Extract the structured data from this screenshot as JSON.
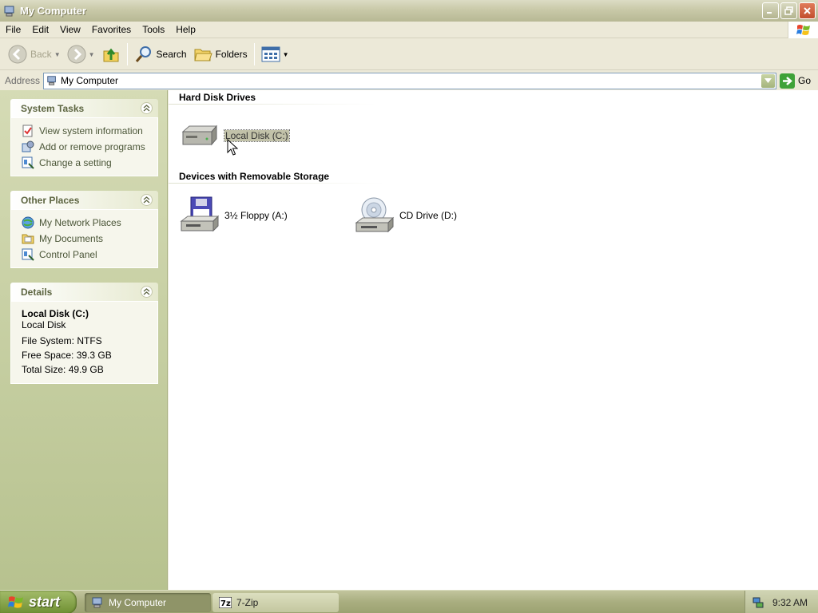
{
  "window": {
    "title": "My Computer",
    "icon": "my-computer-icon"
  },
  "menu": [
    "File",
    "Edit",
    "View",
    "Favorites",
    "Tools",
    "Help"
  ],
  "toolbar": {
    "back": "Back",
    "search": "Search",
    "folders": "Folders"
  },
  "address": {
    "label": "Address",
    "value": "My Computer",
    "go": "Go"
  },
  "system_tasks": {
    "title": "System Tasks",
    "items": [
      {
        "label": "View system information",
        "icon": "system-info-icon"
      },
      {
        "label": "Add or remove programs",
        "icon": "add-remove-programs-icon"
      },
      {
        "label": "Change a setting",
        "icon": "control-panel-icon"
      }
    ]
  },
  "other_places": {
    "title": "Other Places",
    "items": [
      {
        "label": "My Network Places",
        "icon": "network-places-icon"
      },
      {
        "label": "My Documents",
        "icon": "my-documents-icon"
      },
      {
        "label": "Control Panel",
        "icon": "control-panel-icon"
      }
    ]
  },
  "details": {
    "title": "Details",
    "name": "Local Disk (C:)",
    "type": "Local Disk",
    "file_system": "File System: NTFS",
    "free_space": "Free Space: 39.3 GB",
    "total_size": "Total Size: 49.9 GB"
  },
  "groups": {
    "hard_disks": {
      "title": "Hard Disk Drives",
      "drives": [
        {
          "label": "Local Disk (C:)",
          "icon": "hard-disk-icon",
          "selected": true
        }
      ]
    },
    "removable": {
      "title": "Devices with Removable Storage",
      "drives": [
        {
          "label": "3½ Floppy (A:)",
          "icon": "floppy-drive-icon"
        },
        {
          "label": "CD Drive (D:)",
          "icon": "cd-drive-icon"
        }
      ]
    }
  },
  "taskbar": {
    "start": "start",
    "tasks": [
      {
        "label": "My Computer",
        "active": true
      },
      {
        "label": "7-Zip",
        "active": false
      }
    ],
    "clock": "9:32 AM"
  },
  "colors": {
    "left_pane": "#c6cf9f",
    "selection": "#c2c2a9",
    "panel_heading": "#5d6541"
  }
}
